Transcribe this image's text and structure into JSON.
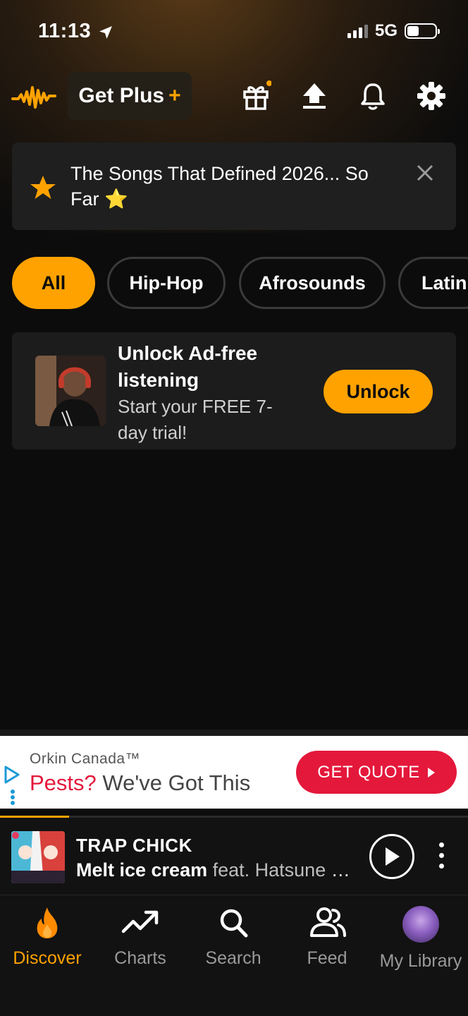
{
  "status_bar": {
    "time": "11:13",
    "network": "5G"
  },
  "header": {
    "get_plus_label": "Get Plus",
    "get_plus_symbol": "+"
  },
  "banner": {
    "text": "The Songs That Defined 2026... So Far ⭐"
  },
  "genres": [
    {
      "label": "All",
      "active": true
    },
    {
      "label": "Hip-Hop",
      "active": false
    },
    {
      "label": "Afrosounds",
      "active": false
    },
    {
      "label": "Latin",
      "active": false
    }
  ],
  "unlock_card": {
    "title": "Unlock Ad-free listening",
    "subtitle": "Start your FREE 7-day trial!",
    "button_label": "Unlock"
  },
  "ad": {
    "brand": "Orkin Canada™",
    "headline_red": "Pests?",
    "headline_rest": " We've Got This",
    "cta_label": "GET QUOTE"
  },
  "now_playing": {
    "artist": "TRAP CHICK",
    "song": "Melt ice cream",
    "featuring": " feat. Hatsune mi...",
    "progress": 0.147
  },
  "bottom_nav": [
    {
      "label": "Discover",
      "icon": "flame-icon",
      "active": true
    },
    {
      "label": "Charts",
      "icon": "trend-icon",
      "active": false
    },
    {
      "label": "Search",
      "icon": "search-icon",
      "active": false
    },
    {
      "label": "Feed",
      "icon": "people-icon",
      "active": false
    },
    {
      "label": "My Library",
      "icon": "avatar-icon",
      "active": false
    }
  ],
  "colors": {
    "accent": "#ffa200",
    "ad_red": "#e4183b",
    "background": "#0c0c0c"
  }
}
